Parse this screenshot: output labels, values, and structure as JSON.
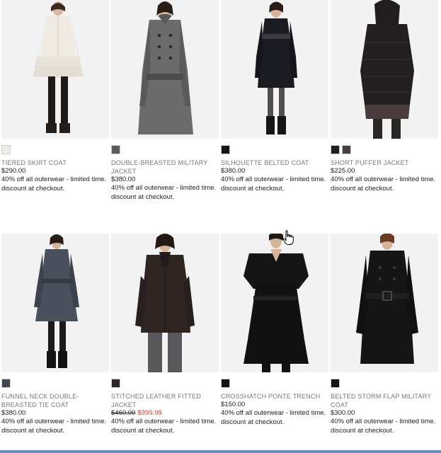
{
  "colors": {
    "sale_price": "#c0392b",
    "bottom_bar": "#6d8ebc"
  },
  "products": [
    {
      "name": "TIERED SKIRT COAT",
      "price": "$290.00",
      "promo": "40% off all outerwear - limited time. discount at checkout.",
      "swatches": [
        "#efece6"
      ]
    },
    {
      "name": "DOUBLE-BREASTED MILITARY JACKET",
      "price": "$380.00",
      "promo": "40% off all outerwear - limited time. discount at checkout.",
      "swatches": [
        "#5a5a5a"
      ]
    },
    {
      "name": "SILHOUETTE BELTED COAT",
      "price": "$380.00",
      "promo": "40% off all outerwear - limited time. discount at checkout.",
      "swatches": [
        "#161616"
      ]
    },
    {
      "name": "SHORT PUFFER JACKET",
      "price": "$225.00",
      "promo": "40% off all outerwear - limited time. discount at checkout.",
      "swatches": [
        "#231f20",
        "#4a3d3e"
      ]
    },
    {
      "name": "FUNNEL NECK DOUBLE-BREASTED TIE COAT",
      "price": "$380.00",
      "promo": "40% off all outerwear - limited time. discount at checkout.",
      "swatches": [
        "#3f4652"
      ]
    },
    {
      "name": "STITCHED LEATHER FITTED JACKET",
      "price_original": "$460.00",
      "price_sale": "$399.99",
      "promo": "40% off all outerwear - limited time. discount at checkout.",
      "swatches": [
        "#2e2523"
      ]
    },
    {
      "name": "CROSSHATCH PONTE TRENCH",
      "price": "$150.00",
      "promo": "40% off all outerwear - limited time. discount at checkout.",
      "swatches": [
        "#141414"
      ]
    },
    {
      "name": "BELTED STORM FLAP MILITARY COAT",
      "price": "$300.00",
      "promo": "40% off all outerwear - limited time. discount at checkout.",
      "swatches": [
        "#141414"
      ]
    }
  ]
}
